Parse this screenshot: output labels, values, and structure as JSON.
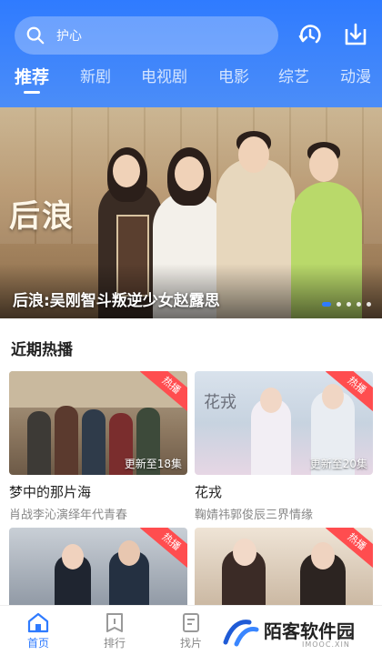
{
  "header": {
    "search": {
      "placeholder": "护心"
    },
    "icons": [
      "refresh-icon",
      "download-icon"
    ],
    "tabs": [
      {
        "label": "推荐",
        "active": true
      },
      {
        "label": "新剧",
        "active": false
      },
      {
        "label": "电视剧",
        "active": false
      },
      {
        "label": "电影",
        "active": false
      },
      {
        "label": "综艺",
        "active": false
      },
      {
        "label": "动漫",
        "active": false
      }
    ]
  },
  "banner": {
    "logo_text": "后浪",
    "caption": "后浪:吴刚智斗叛逆少女赵露思",
    "page_count": 5,
    "active_page": 1
  },
  "section": {
    "title": "近期热播"
  },
  "cards": [
    {
      "title": "梦中的那片海",
      "desc": "肖战李沁演绎年代青春",
      "badge": "热播",
      "update": "更新至18集"
    },
    {
      "title": "花戎",
      "desc": "鞠婧祎郭俊辰三界情缘",
      "badge": "热播",
      "update": "更新至20集",
      "poster_text": "花戎"
    },
    {
      "title": "",
      "desc": "",
      "badge": "热播",
      "update": ""
    },
    {
      "title": "",
      "desc": "",
      "badge": "热播",
      "update": ""
    }
  ],
  "bottom_nav": [
    {
      "label": "首页",
      "icon": "home-icon",
      "active": true
    },
    {
      "label": "排行",
      "icon": "rank-icon",
      "active": false
    },
    {
      "label": "找片",
      "icon": "filter-icon",
      "active": false
    }
  ],
  "watermark": {
    "text": "陌客软件园",
    "sub": "IMOOC.XIN"
  },
  "colors": {
    "accent": "#2f7bff",
    "badge": "#ff4d4f"
  }
}
